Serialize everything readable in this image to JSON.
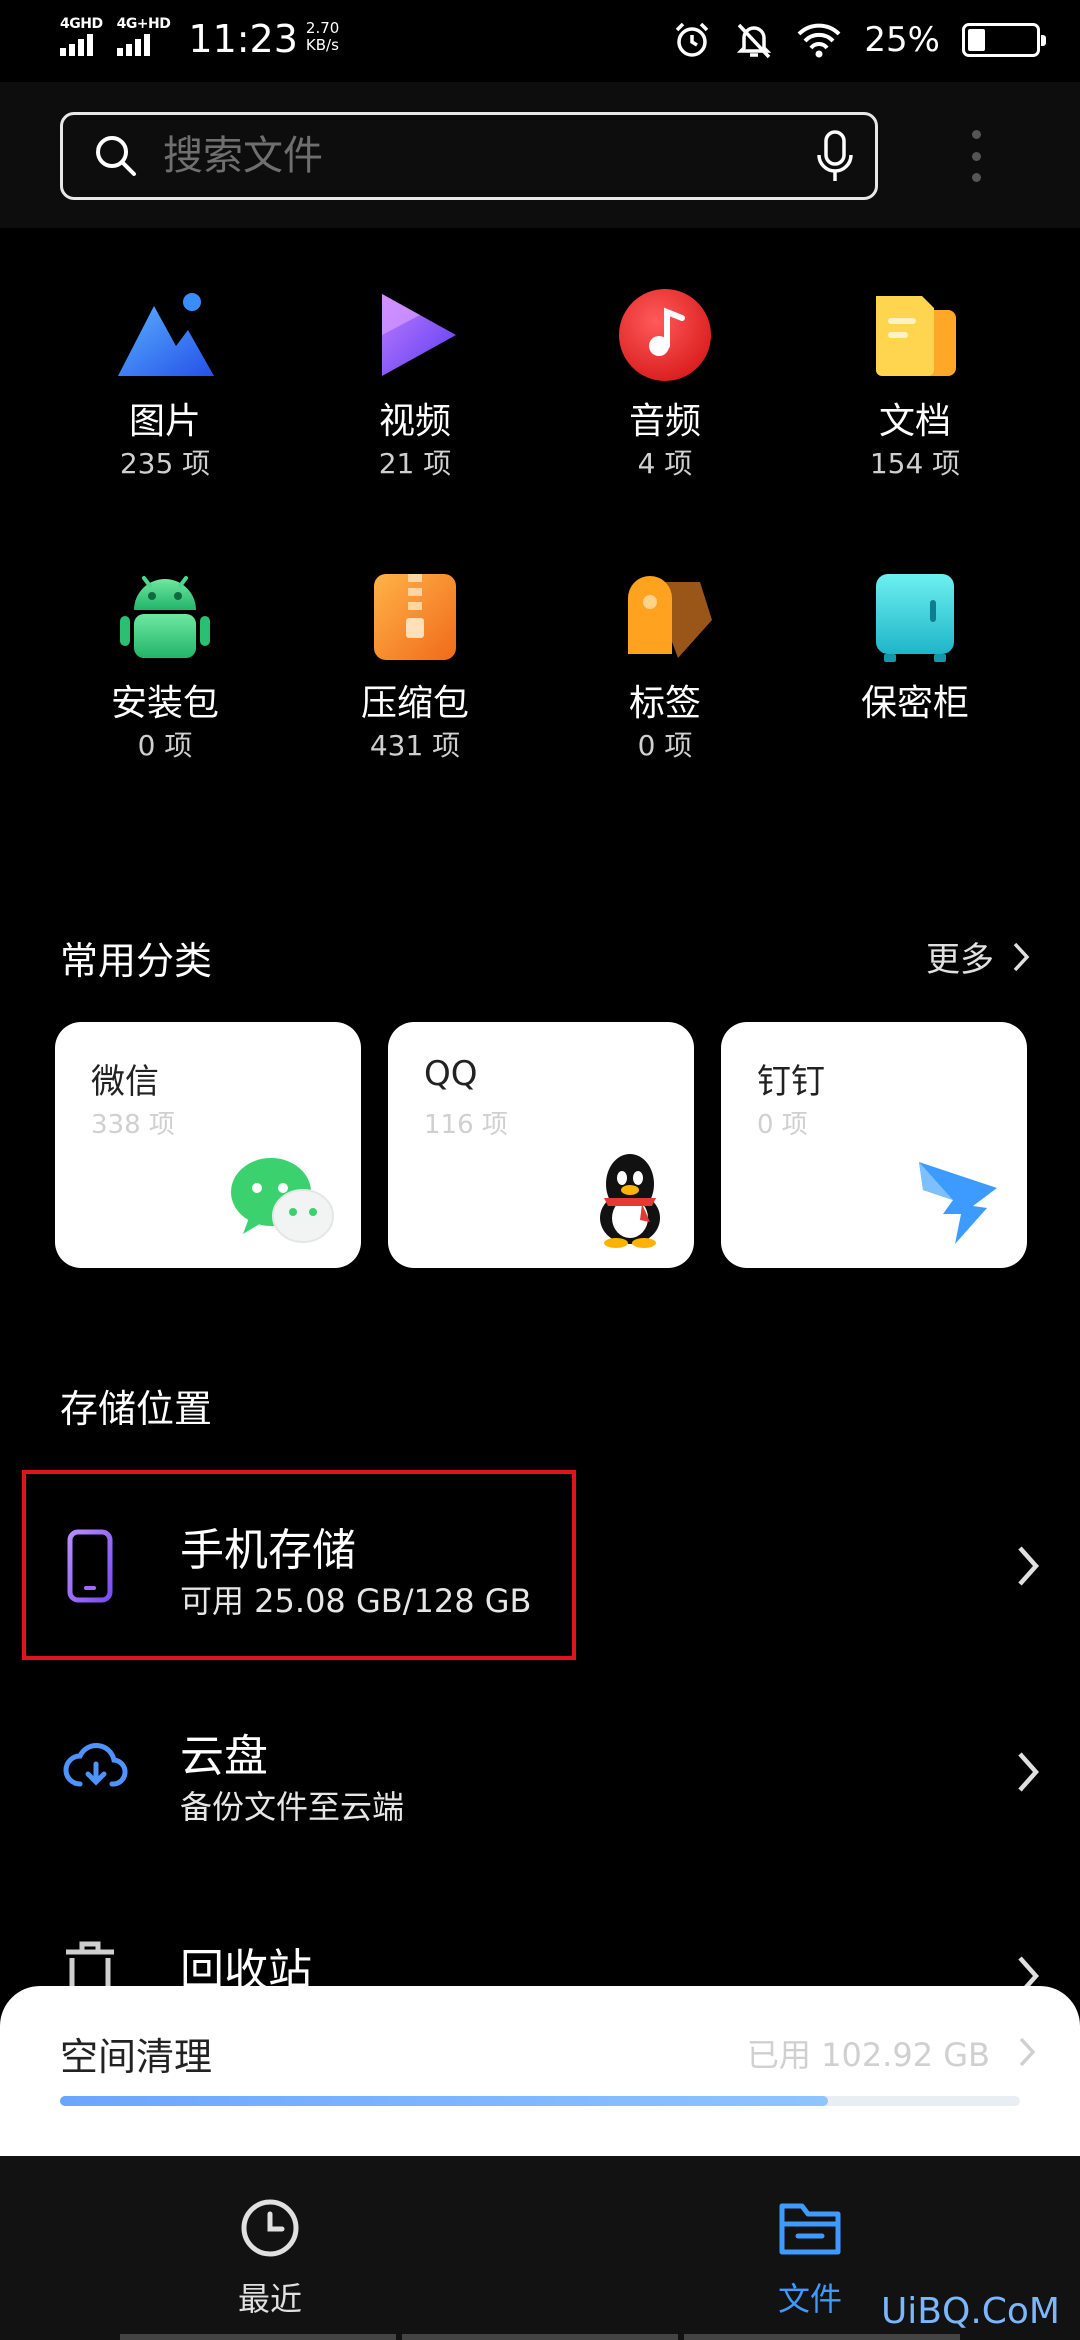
{
  "status_bar": {
    "network_1": "4GHD",
    "network_2": "4G+HD",
    "time": "11:23",
    "speed_value": "2.70",
    "speed_unit": "KB/s",
    "battery_percent": "25%",
    "battery_level": 0.25
  },
  "search": {
    "placeholder": "搜索文件"
  },
  "categories": [
    {
      "name": "图片",
      "count": "235 项",
      "icon": "image-icon"
    },
    {
      "name": "视频",
      "count": "21 项",
      "icon": "video-icon"
    },
    {
      "name": "音频",
      "count": "4 项",
      "icon": "audio-icon"
    },
    {
      "name": "文档",
      "count": "154 项",
      "icon": "document-icon"
    },
    {
      "name": "安装包",
      "count": "0 项",
      "icon": "android-icon"
    },
    {
      "name": "压缩包",
      "count": "431 项",
      "icon": "archive-icon"
    },
    {
      "name": "标签",
      "count": "0 项",
      "icon": "tag-icon"
    },
    {
      "name": "保密柜",
      "count": "",
      "icon": "safe-icon"
    }
  ],
  "common": {
    "title": "常用分类",
    "more": "更多",
    "apps": [
      {
        "name": "微信",
        "count": "338 项",
        "icon": "wechat-icon"
      },
      {
        "name": "QQ",
        "count": "116 项",
        "icon": "qq-icon"
      },
      {
        "name": "钉钉",
        "count": "0 项",
        "icon": "dingtalk-icon"
      }
    ]
  },
  "storage": {
    "title": "存储位置",
    "phone": {
      "title": "手机存储",
      "subtitle": "可用 25.08 GB/128 GB"
    },
    "cloud": {
      "title": "云盘",
      "subtitle": "备份文件至云端"
    },
    "recycle": {
      "title": "回收站"
    }
  },
  "cleanup": {
    "title": "空间清理",
    "used": "已用 102.92 GB",
    "used_fraction": 0.8
  },
  "nav": {
    "recent": "最近",
    "files": "文件"
  },
  "watermark": "UiBQ.CoM",
  "colors": {
    "accent": "#3d9bff",
    "highlight": "#e0141e"
  }
}
